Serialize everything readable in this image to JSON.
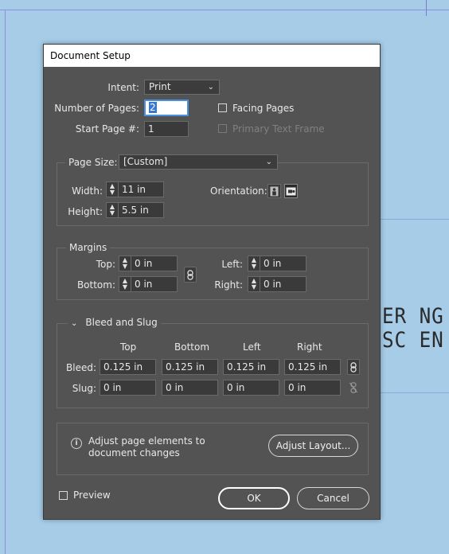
{
  "dialog": {
    "title": "Document Setup"
  },
  "intent": {
    "label": "Intent:",
    "value": "Print"
  },
  "pages": {
    "number_label": "Number of Pages:",
    "number_value": "2",
    "start_label": "Start Page #:",
    "start_value": "1",
    "facing_label": "Facing Pages",
    "primary_label": "Primary Text Frame"
  },
  "page_size": {
    "label": "Page Size:",
    "value": "[Custom]",
    "width_label": "Width:",
    "width_value": "11 in",
    "height_label": "Height:",
    "height_value": "5.5 in",
    "orientation_label": "Orientation:"
  },
  "margins": {
    "title": "Margins",
    "top_label": "Top:",
    "top_value": "0 in",
    "bottom_label": "Bottom:",
    "bottom_value": "0 in",
    "left_label": "Left:",
    "left_value": "0 in",
    "right_label": "Right:",
    "right_value": "0 in"
  },
  "bleed_slug": {
    "title": "Bleed and Slug",
    "columns": [
      "Top",
      "Bottom",
      "Left",
      "Right"
    ],
    "bleed_label": "Bleed:",
    "bleed_values": [
      "0.125 in",
      "0.125 in",
      "0.125 in",
      "0.125 in"
    ],
    "slug_label": "Slug:",
    "slug_values": [
      "0 in",
      "0 in",
      "0 in",
      "0 in"
    ]
  },
  "adjust": {
    "message": "Adjust page elements to document changes",
    "button": "Adjust Layout..."
  },
  "footer": {
    "preview_label": "Preview",
    "ok": "OK",
    "cancel": "Cancel"
  },
  "background": {
    "line1": "ER NG A",
    "line2": "SC EN"
  }
}
